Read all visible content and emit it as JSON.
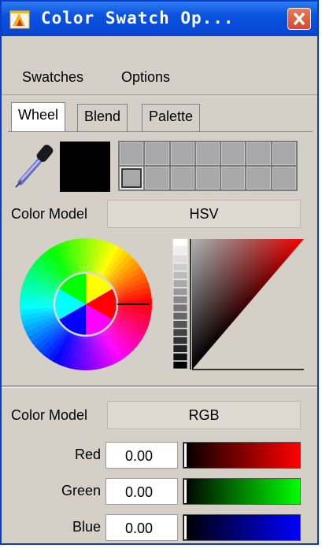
{
  "window": {
    "title": "Color Swatch Op...",
    "close_icon": "close-icon",
    "app_icon": "app-icon"
  },
  "menubar": {
    "items": [
      {
        "label": "Swatches"
      },
      {
        "label": "Options"
      }
    ]
  },
  "tabs": [
    {
      "label": "Wheel",
      "active": true
    },
    {
      "label": "Blend",
      "active": false
    },
    {
      "label": "Palette",
      "active": false
    }
  ],
  "swatches": {
    "current_color": "#000000",
    "grid_rows": 2,
    "grid_cols": 7,
    "cell_color": "#a8a8a8",
    "selected_cell": 7
  },
  "color_model_top": {
    "label": "Color Model",
    "value": "HSV"
  },
  "color_model_bottom": {
    "label": "Color Model",
    "value": "RGB"
  },
  "channels": [
    {
      "label": "Red",
      "value": "0.00",
      "color": "#ff0000",
      "level": 0.0
    },
    {
      "label": "Green",
      "value": "0.00",
      "color": "#00ff00",
      "level": 0.0
    },
    {
      "label": "Blue",
      "value": "0.00",
      "color": "#0000ff",
      "level": 0.0
    }
  ],
  "colors": {
    "titlebar": "#0a52e0",
    "window_bg": "#d4d0c8",
    "hue_selected": "#ff0000"
  }
}
